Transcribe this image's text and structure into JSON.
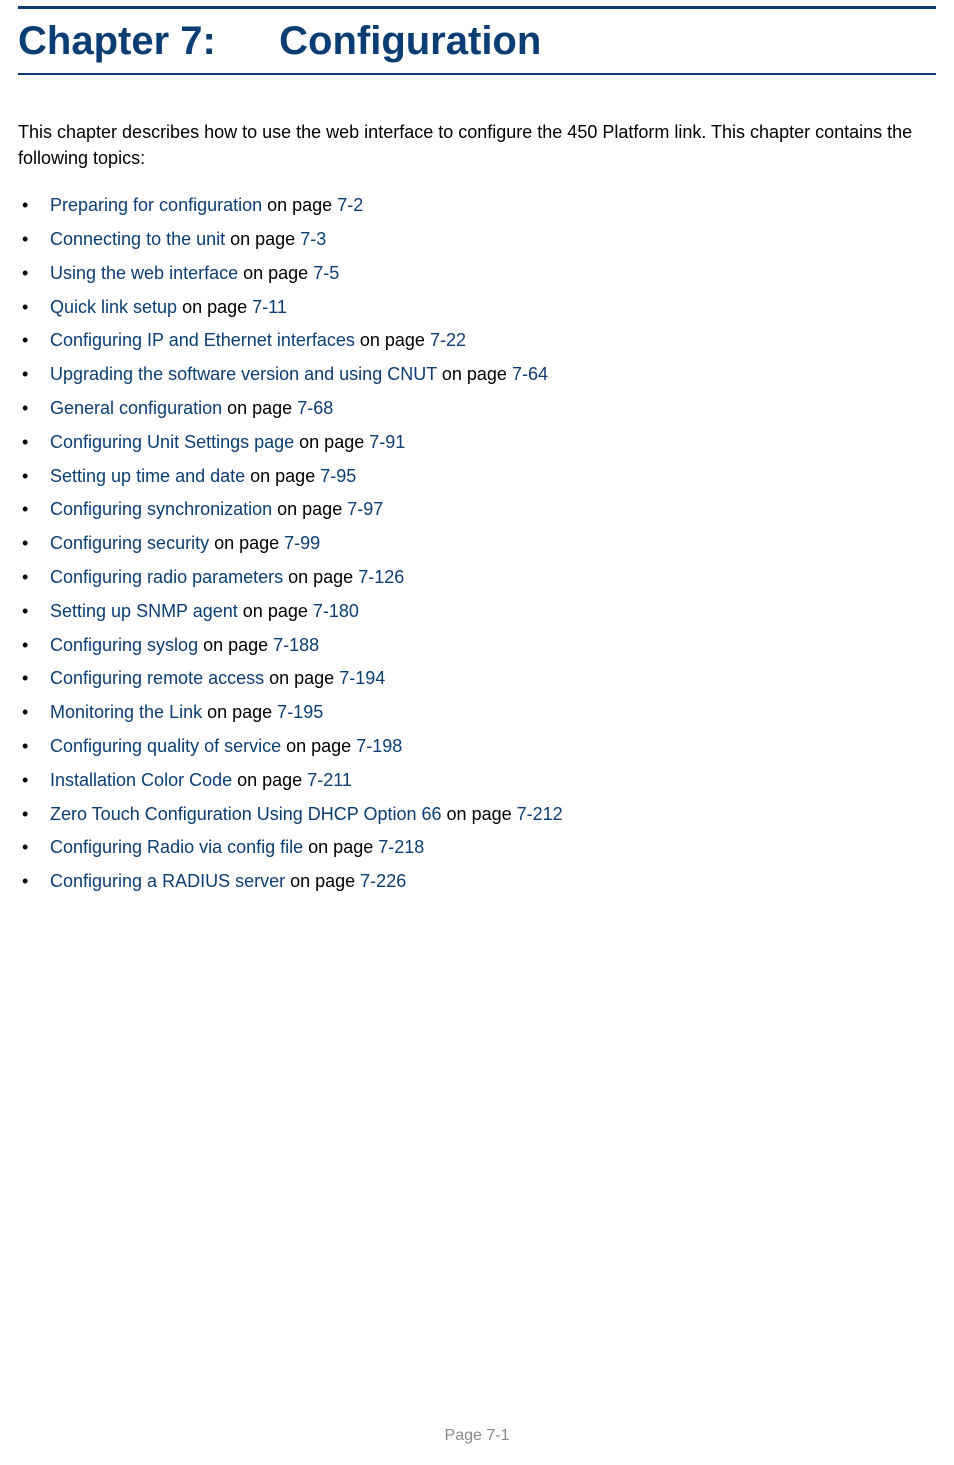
{
  "heading": {
    "label": "Chapter 7:",
    "title": "Configuration"
  },
  "intro": "This chapter describes how to use the web interface to configure the 450 Platform link. This chapter contains the following topics:",
  "on_page_text": " on page ",
  "toc": [
    {
      "link": "Preparing for configuration",
      "page": "7-2"
    },
    {
      "link": "Connecting to the unit",
      "page": "7-3"
    },
    {
      "link": "Using the web interface",
      "page": "7-5"
    },
    {
      "link": "Quick link setup",
      "page": "7-11"
    },
    {
      "link": "Configuring IP and Ethernet interfaces",
      "page": "7-22"
    },
    {
      "link": "Upgrading the software version and using CNUT",
      "page": "7-64"
    },
    {
      "link": "General configuration",
      "page": "7-68"
    },
    {
      "link": "Configuring Unit Settings page",
      "page": "7-91"
    },
    {
      "link": "Setting up time and date",
      "page": "7-95"
    },
    {
      "link": "Configuring synchronization",
      "page": "7-97"
    },
    {
      "link": "Configuring security",
      "page": "7-99"
    },
    {
      "link": "Configuring radio parameters",
      "page": "7-126"
    },
    {
      "link": "Setting up SNMP agent",
      "page": "7-180"
    },
    {
      "link": "Configuring syslog",
      "page": "7-188"
    },
    {
      "link": "Configuring remote access",
      "page": "7-194"
    },
    {
      "link": "Monitoring the Link",
      "page": "7-195"
    },
    {
      "link": "Configuring quality of service",
      "page": "7-198"
    },
    {
      "link": "Installation Color Code",
      "page": "7-211"
    },
    {
      "link": "Zero Touch Configuration Using DHCP Option 66",
      "page": "7-212"
    },
    {
      "link": "Configuring Radio via config file",
      "page": "7-218"
    },
    {
      "link": "Configuring a RADIUS server",
      "page": "7-226"
    }
  ],
  "footer": "Page 7-1"
}
